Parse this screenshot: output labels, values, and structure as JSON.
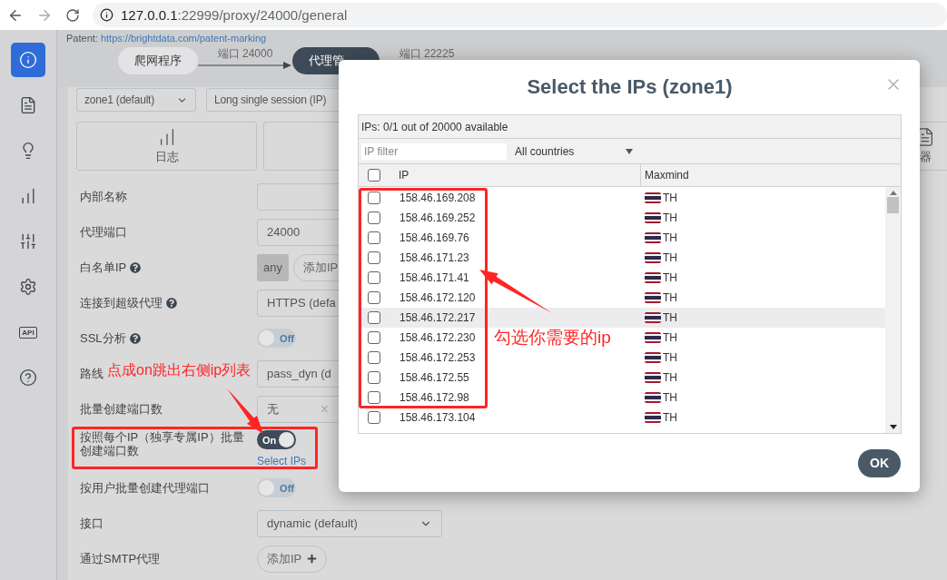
{
  "browser": {
    "host": "127.0.0.1",
    "path": ":22999/proxy/24000/general"
  },
  "sidebar": {
    "items": [
      {
        "kind": "info",
        "selected": true
      },
      {
        "kind": "list",
        "selected": false
      },
      {
        "kind": "bulb",
        "selected": false
      },
      {
        "kind": "chart",
        "selected": false
      },
      {
        "kind": "sliders",
        "selected": false
      },
      {
        "kind": "gear",
        "selected": false
      },
      {
        "kind": "api",
        "label": "API",
        "selected": false
      },
      {
        "kind": "help",
        "selected": false
      }
    ]
  },
  "patent": {
    "label": "Patent:",
    "link": "https://brightdata.com/patent-marking"
  },
  "steps": [
    {
      "kind": "pill",
      "label": "爬网程序",
      "selected": false
    },
    {
      "kind": "connector",
      "label": "端口 24000",
      "arrow": true
    },
    {
      "kind": "pill",
      "label": "代理管",
      "selected": true
    },
    {
      "kind": "connector",
      "label": "端口 22225",
      "arrow": false
    }
  ],
  "top_selects": [
    {
      "value": "zone1 (default)",
      "caret": true
    },
    {
      "value": "Long single session (IP)",
      "caret": false
    }
  ],
  "cards": [
    {
      "kind": "logs",
      "label": "日志"
    },
    {
      "kind": "blank"
    },
    {
      "kind": "device",
      "label": "器"
    }
  ],
  "form": [
    {
      "kind": "input",
      "label": "内部名称",
      "help": false
    },
    {
      "kind": "input",
      "label": "代理端口",
      "help": false,
      "value": "24000"
    },
    {
      "kind": "ip_list",
      "label": "白名单IP",
      "help": true,
      "chip": "any",
      "button": "添加IP"
    },
    {
      "kind": "select",
      "label": "连接到超级代理",
      "help": true,
      "value": "HTTPS (defa",
      "caret": false
    },
    {
      "kind": "toggle",
      "label": "SSL分析",
      "help": true,
      "on": false,
      "state_text": "Off"
    },
    {
      "kind": "select",
      "label": "路线",
      "help": false,
      "value": "pass_dyn (d",
      "caret": false
    },
    {
      "kind": "clearable",
      "label": "批量创建端口数",
      "help": false,
      "value": "无",
      "clear": "×"
    },
    {
      "kind": "toggle",
      "label": "按照每个IP（独享专属IP）批量创建端口数",
      "help": false,
      "on": true,
      "state_text": "On",
      "link": "Select IPs"
    },
    {
      "kind": "toggle",
      "label": "按用户批量创建代理端口",
      "help": false,
      "on": false,
      "state_text": "Off"
    },
    {
      "kind": "select",
      "label": "接口",
      "help": false,
      "value": "dynamic (default)",
      "caret": true
    },
    {
      "kind": "button",
      "label": "通过SMTP代理",
      "help": false,
      "button": "添加IP"
    }
  ],
  "modal": {
    "title": "Select the IPs (zone1)",
    "summary": "IPs: 0/1 out of 20000 available",
    "filter": {
      "placeholder": "IP filter"
    },
    "country": "All countries",
    "columns": [
      {
        "label": "IP",
        "checked": false
      },
      {
        "label": "Maxmind"
      }
    ],
    "rows": [
      {
        "ip": "158.46.169.208",
        "country": "TH",
        "checked": false,
        "highlighted": false
      },
      {
        "ip": "158.46.169.252",
        "country": "TH",
        "checked": false,
        "highlighted": false
      },
      {
        "ip": "158.46.169.76",
        "country": "TH",
        "checked": false,
        "highlighted": false
      },
      {
        "ip": "158.46.171.23",
        "country": "TH",
        "checked": false,
        "highlighted": false
      },
      {
        "ip": "158.46.171.41",
        "country": "TH",
        "checked": false,
        "highlighted": false
      },
      {
        "ip": "158.46.172.120",
        "country": "TH",
        "checked": false,
        "highlighted": false
      },
      {
        "ip": "158.46.172.217",
        "country": "TH",
        "checked": false,
        "highlighted": true
      },
      {
        "ip": "158.46.172.230",
        "country": "TH",
        "checked": false,
        "highlighted": false
      },
      {
        "ip": "158.46.172.253",
        "country": "TH",
        "checked": false,
        "highlighted": false
      },
      {
        "ip": "158.46.172.55",
        "country": "TH",
        "checked": false,
        "highlighted": false
      },
      {
        "ip": "158.46.172.98",
        "country": "TH",
        "checked": false,
        "highlighted": false
      },
      {
        "ip": "158.46.173.104",
        "country": "TH",
        "checked": false,
        "highlighted": false
      }
    ],
    "ok": "OK"
  },
  "annotations": [
    {
      "text": "点成on跳出右侧ip列表"
    },
    {
      "text": "勾选你需要的ip"
    }
  ]
}
